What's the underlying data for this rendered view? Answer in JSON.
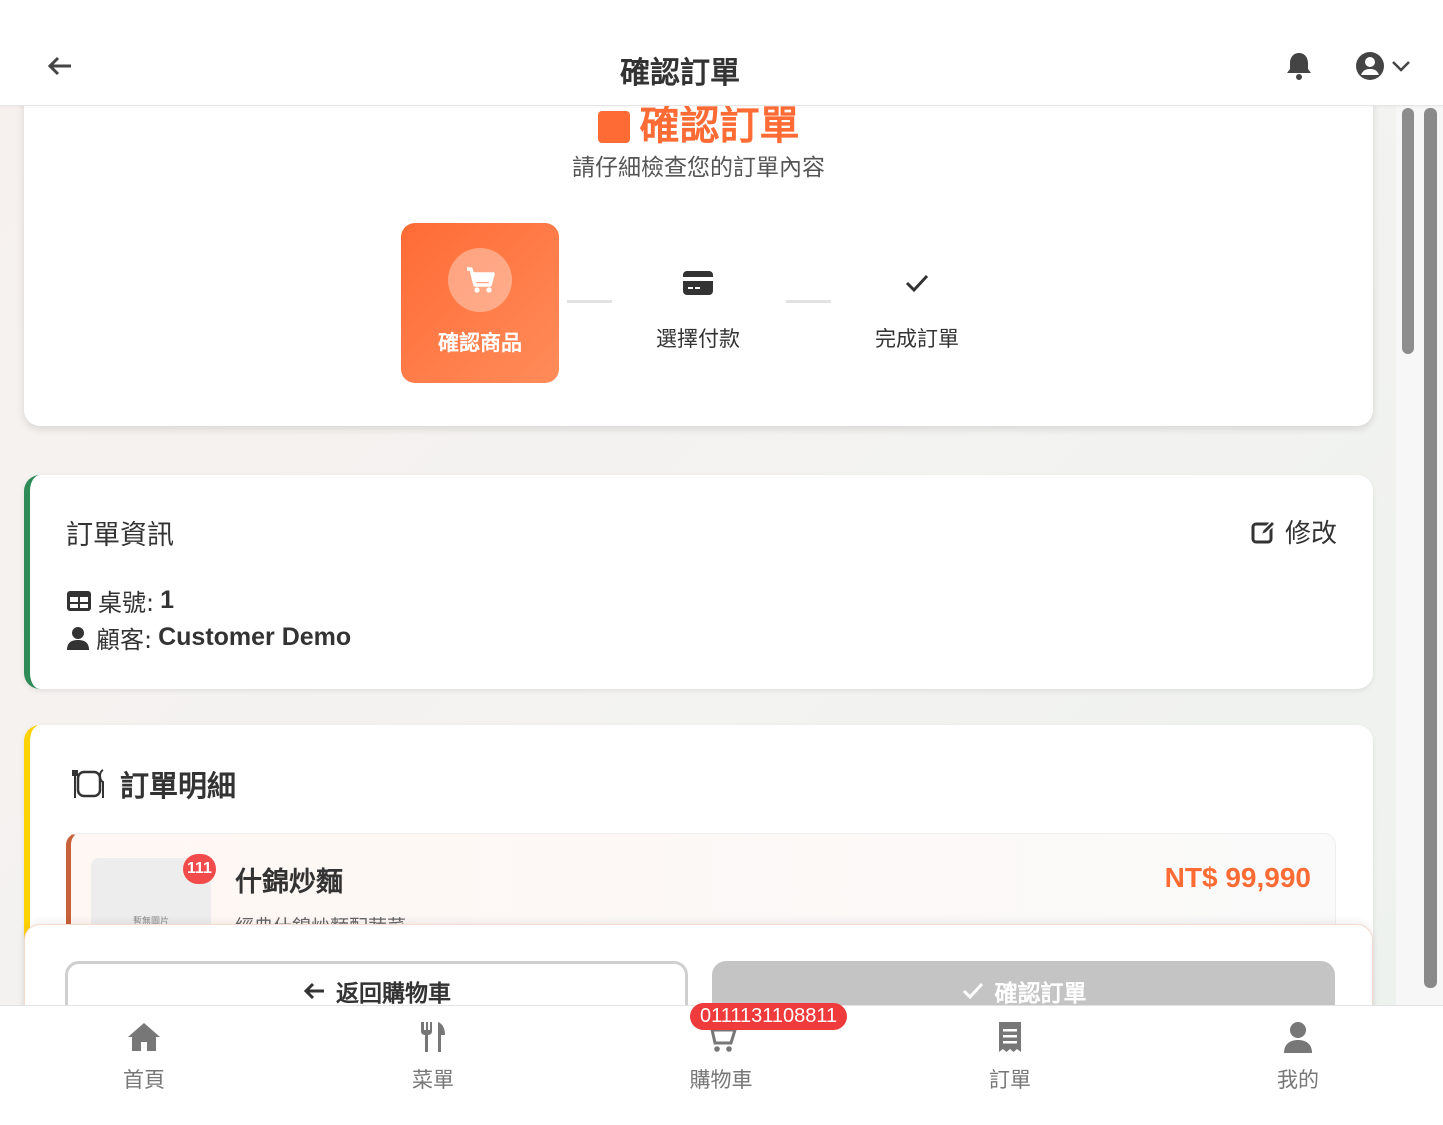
{
  "header": {
    "title": "確認訂單"
  },
  "hero": {
    "title": "確認訂單",
    "subtitle": "請仔細檢查您的訂單內容"
  },
  "steps": [
    {
      "label": "確認商品",
      "icon": "cart-icon",
      "active": true
    },
    {
      "label": "選擇付款",
      "icon": "credit-card-icon",
      "active": false
    },
    {
      "label": "完成訂單",
      "icon": "check-icon",
      "active": false
    }
  ],
  "order_info": {
    "title": "訂單資訊",
    "edit_label": "修改",
    "table_label": "桌號:",
    "table_value": "1",
    "customer_label": "顧客:",
    "customer_value": "Customer Demo"
  },
  "order_detail": {
    "title": "訂單明細",
    "items": [
      {
        "name": "什錦炒麵",
        "description": "經典什錦炒麵配蔬菜",
        "price": "NT$ 99,990",
        "quantity": "111",
        "thumb_text": "暫無圖片"
      }
    ]
  },
  "actions": {
    "back_label": "返回購物車",
    "confirm_label": "確認訂單"
  },
  "bottom_nav": {
    "items": [
      {
        "label": "首頁",
        "icon": "home-icon"
      },
      {
        "label": "菜單",
        "icon": "utensils-icon"
      },
      {
        "label": "購物車",
        "icon": "cart-icon"
      },
      {
        "label": "訂單",
        "icon": "receipt-icon"
      },
      {
        "label": "我的",
        "icon": "user-icon"
      }
    ],
    "cart_badge": "0111131108811"
  },
  "colors": {
    "accent": "#ff6b35",
    "info_border": "#2e8b57",
    "detail_border": "#ffd200",
    "badge": "#ef3b3b",
    "disabled": "#c4c4c4"
  }
}
